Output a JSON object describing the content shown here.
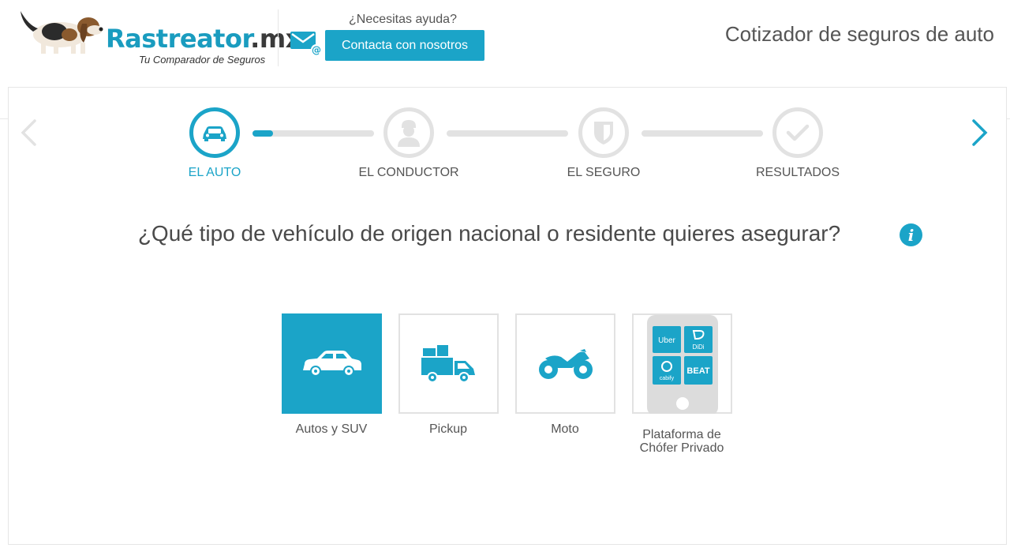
{
  "header": {
    "logo_name": "Rastreator",
    "logo_suffix": ".mx",
    "logo_tagline": "Tu Comparador de Seguros",
    "help_label": "¿Necesitas ayuda?",
    "contact_button": "Contacta con nosotros",
    "page_title": "Cotizador de seguros de auto"
  },
  "steps": [
    {
      "label": "EL AUTO",
      "icon": "car-icon",
      "state": "active"
    },
    {
      "label": "EL CONDUCTOR",
      "icon": "driver-icon",
      "state": "pending"
    },
    {
      "label": "EL SEGURO",
      "icon": "shield-icon",
      "state": "pending"
    },
    {
      "label": "RESULTADOS",
      "icon": "checkmark-icon",
      "state": "pending"
    }
  ],
  "progress": {
    "first_segment_fraction": 0.16
  },
  "question": "¿Qué tipo de vehículo de origen nacional o residente quieres asegurar?",
  "info_glyph": "i",
  "options": [
    {
      "label": "Autos y SUV",
      "icon": "car-icon",
      "selected": true
    },
    {
      "label": "Pickup",
      "icon": "pickup-truck-icon",
      "selected": false
    },
    {
      "label": "Moto",
      "icon": "motorcycle-icon",
      "selected": false
    },
    {
      "label_line1": "Plataforma de",
      "label_line2": "Chófer Privado",
      "icon": "rideshare-apps-icon",
      "selected": false
    }
  ],
  "rideshare_apps": [
    "Uber",
    "DiDi",
    "cabify",
    "BEAT"
  ],
  "colors": {
    "accent": "#1ba4c8",
    "inactive": "#e2e2e2",
    "text": "#555555"
  }
}
